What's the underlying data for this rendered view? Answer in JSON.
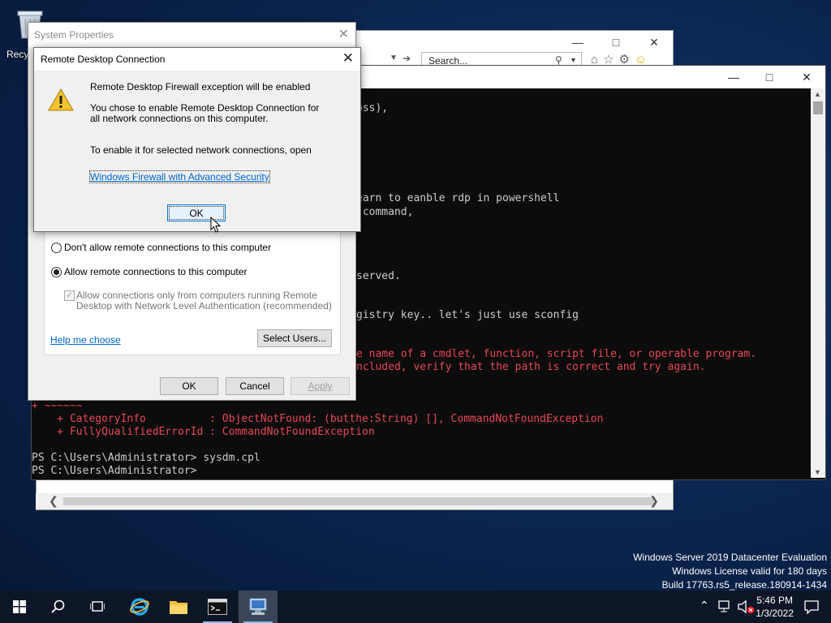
{
  "desktop": {
    "recycle_bin_label": "Recy"
  },
  "ie_window": {
    "search_placeholder": "Search..."
  },
  "console": {
    "lines": [
      {
        "text": "oss),",
        "color": "normal"
      },
      {
        "text": "earn to eanble rdp in powershell",
        "color": "normal"
      },
      {
        "text": " command,",
        "color": "normal"
      },
      {
        "text": "served.",
        "color": "normal"
      },
      {
        "text": "gistry key.. let's just use sconfig",
        "color": "normal"
      },
      {
        "text": "e name of a cmdlet, function, script file, or operable program.",
        "color": "red"
      },
      {
        "text": "ncluded, verify that the path is correct and try again.",
        "color": "red"
      },
      {
        "text": "+ ~~~~~~",
        "color": "red"
      },
      {
        "text": "    + CategoryInfo          : ObjectNotFound: (butthe:String) [], CommandNotFoundException",
        "color": "red"
      },
      {
        "text": "    + FullyQualifiedErrorId : CommandNotFoundException",
        "color": "red"
      },
      {
        "text": "PS C:\\Users\\Administrator> sysdm.cpl",
        "color": "normal"
      },
      {
        "text": "PS C:\\Users\\Administrator>",
        "color": "normal"
      }
    ]
  },
  "system_properties": {
    "title": "System Properties",
    "radio_dont_allow": "Don't allow remote connections to this computer",
    "radio_allow": "Allow remote connections to this computer",
    "nla_line1": "Allow connections only from computers running Remote",
    "nla_line2": "Desktop with Network Level Authentication (recommended)",
    "help_link": "Help me choose",
    "select_users": "Select Users...",
    "ok": "OK",
    "cancel": "Cancel",
    "apply": "Apply"
  },
  "rdc_dialog": {
    "title": "Remote Desktop Connection",
    "heading": "Remote Desktop Firewall exception will be enabled",
    "msg_line1": "You chose to enable Remote Desktop Connection for",
    "msg_line2": "all network connections on this computer.",
    "msg_line3": "To enable it for selected network connections, open",
    "link": "Windows Firewall with Advanced Security",
    "ok": "OK"
  },
  "watermark": {
    "line1": "Windows Server 2019 Datacenter Evaluation",
    "line2": "Windows License valid for 180 days",
    "line3": "Build 17763.rs5_release.180914-1434"
  },
  "taskbar": {
    "time": "5:46 PM",
    "date": "1/3/2022"
  },
  "colors": {
    "console_bg": "#0c0c0c",
    "console_text": "#cccccc",
    "console_error": "#e74856",
    "accent": "#0078d7",
    "taskbar_bg": "#0d1626"
  }
}
